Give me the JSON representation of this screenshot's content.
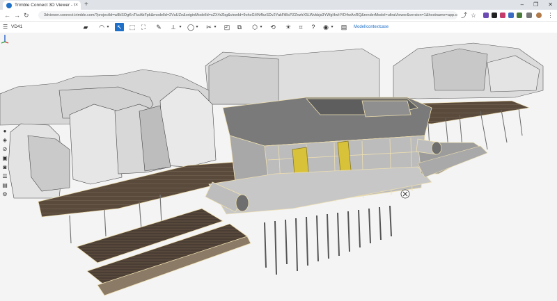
{
  "browser": {
    "tab_title": "Trimble Connect 3D Viewer - VI...",
    "tab_close": "×",
    "new_tab": "+",
    "url": "3dviewer.connect.trimble.com/?projectId=w8kSOgKnTksAbFpk&modelId=2VuUZe&originModelId=sZX4rZbg&viewId=9ohcGHN4kzSDv2YakFtBcPZZnzhX5LWvkbjs3YWgHwHYD4wAnRQ&renderModel=ultraViewer&version=1&hostname=app.connect.trimble.com",
    "window_controls": [
      "–",
      "❐",
      "✕"
    ]
  },
  "toolbar": {
    "model_name": "VD41",
    "mode_link": "Model/contextcase"
  },
  "colors": {
    "accent": "#1e6fc7",
    "building": "#d9d9d9",
    "deck": "#5a4a3c",
    "outline": "#e9d9a8"
  }
}
